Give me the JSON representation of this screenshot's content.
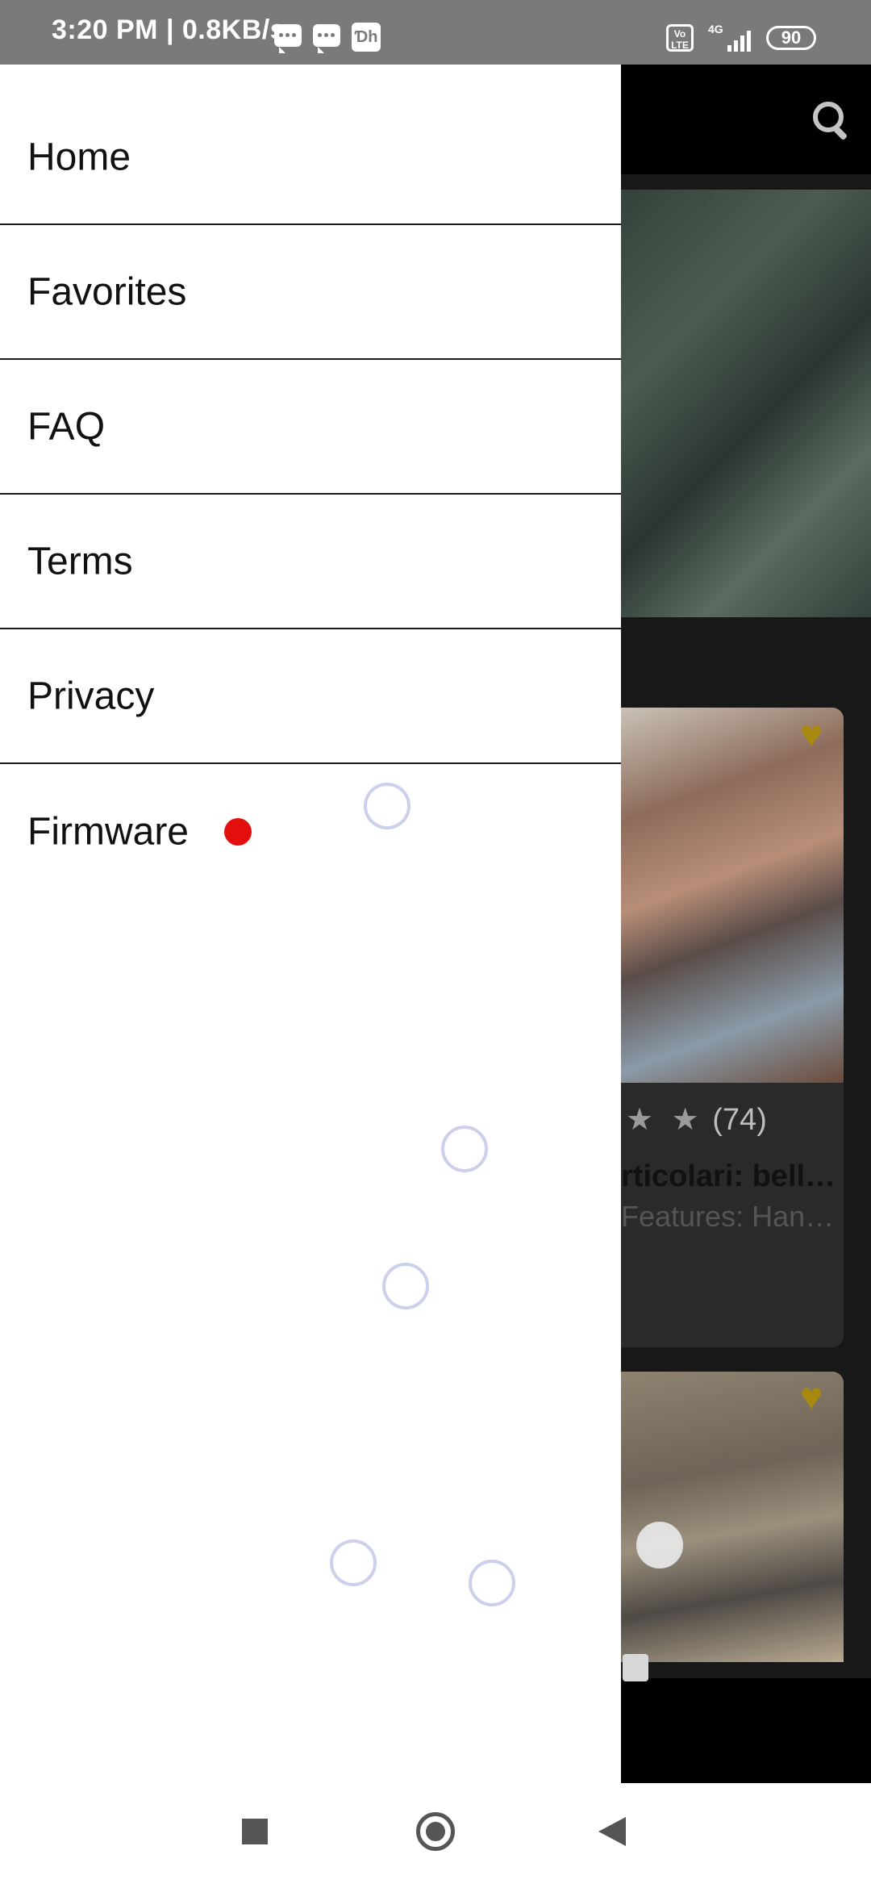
{
  "status_bar": {
    "time": "3:20 PM | 0.8KB/s",
    "hotstar_badge": "Ɗh",
    "volte": "Vo LTE",
    "network": "4G",
    "battery": "90"
  },
  "drawer": {
    "items": [
      {
        "label": "Home"
      },
      {
        "label": "Favorites"
      },
      {
        "label": "FAQ"
      },
      {
        "label": "Terms"
      },
      {
        "label": "Privacy"
      },
      {
        "label": "Firmware",
        "badge": "red-dot"
      }
    ]
  },
  "background_app": {
    "card1": {
      "rating_stars": "★ ★",
      "rating_count": "(74)",
      "title": "rticolari: bell…",
      "features": "Features: Han…"
    }
  },
  "icons": {
    "search": "search-icon",
    "favorite": "heart-icon",
    "nav_recent": "square-icon",
    "nav_home": "circle-icon",
    "nav_back": "triangle-back-icon"
  },
  "colors": {
    "status_bar": "#7a7a7a",
    "drawer": "#ffffff",
    "heart": "#a8880f",
    "firmware_dot": "#e30f0f"
  }
}
